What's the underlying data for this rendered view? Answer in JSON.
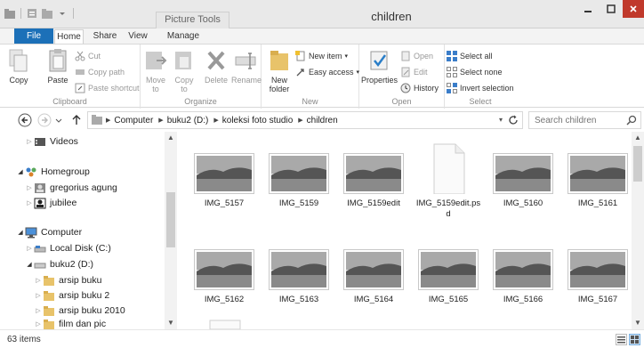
{
  "window": {
    "title": "children",
    "context_tab": "Picture Tools"
  },
  "ribbon_tabs": {
    "file": "File",
    "home": "Home",
    "share": "Share",
    "view": "View",
    "manage": "Manage"
  },
  "ribbon": {
    "clipboard": {
      "label": "Clipboard",
      "copy": "Copy",
      "paste": "Paste",
      "cut": "Cut",
      "copy_path": "Copy path",
      "paste_shortcut": "Paste shortcut"
    },
    "organize": {
      "label": "Organize",
      "move_to": "Move to",
      "copy_to": "Copy to",
      "delete": "Delete",
      "rename": "Rename"
    },
    "new": {
      "label": "New",
      "new_folder": "New folder",
      "new_item": "New item",
      "easy_access": "Easy access"
    },
    "open": {
      "label": "Open",
      "properties": "Properties",
      "open": "Open",
      "edit": "Edit",
      "history": "History"
    },
    "select": {
      "label": "Select",
      "select_all": "Select all",
      "select_none": "Select none",
      "invert_selection": "Invert selection"
    }
  },
  "address": {
    "crumbs": [
      "Computer",
      "buku2 (D:)",
      "koleksi foto studio",
      "children"
    ],
    "search_placeholder": "Search children"
  },
  "nav": {
    "items": [
      {
        "label": "Videos",
        "icon": "videos-icon"
      },
      {
        "label": "Homegroup",
        "icon": "homegroup-icon"
      },
      {
        "label": "gregorius agung",
        "icon": "user-icon"
      },
      {
        "label": "jubilee",
        "icon": "user-icon"
      },
      {
        "label": "Computer",
        "icon": "computer-icon"
      },
      {
        "label": "Local Disk (C:)",
        "icon": "drive-icon"
      },
      {
        "label": "buku2 (D:)",
        "icon": "drive-icon"
      },
      {
        "label": "arsip buku",
        "icon": "folder-icon"
      },
      {
        "label": "arsip buku 2",
        "icon": "folder-icon"
      },
      {
        "label": "arsip buku 2010",
        "icon": "folder-icon"
      },
      {
        "label": "film dan pic",
        "icon": "folder-icon"
      }
    ]
  },
  "files": [
    {
      "name": "IMG_5157",
      "type": "image"
    },
    {
      "name": "IMG_5159",
      "type": "image"
    },
    {
      "name": "IMG_5159edit",
      "type": "image"
    },
    {
      "name": "IMG_5159edit.psd",
      "type": "document"
    },
    {
      "name": "IMG_5160",
      "type": "image"
    },
    {
      "name": "IMG_5161",
      "type": "image"
    },
    {
      "name": "IMG_5162",
      "type": "image"
    },
    {
      "name": "IMG_5163",
      "type": "image"
    },
    {
      "name": "IMG_5164",
      "type": "image"
    },
    {
      "name": "IMG_5165",
      "type": "image"
    },
    {
      "name": "IMG_5166",
      "type": "image"
    },
    {
      "name": "IMG_5167",
      "type": "image"
    }
  ],
  "status": {
    "item_count": "63 items"
  },
  "colors": {
    "file_tab": "#1c70b8",
    "close_button": "#c0392b",
    "folder": "#e8c36a"
  }
}
